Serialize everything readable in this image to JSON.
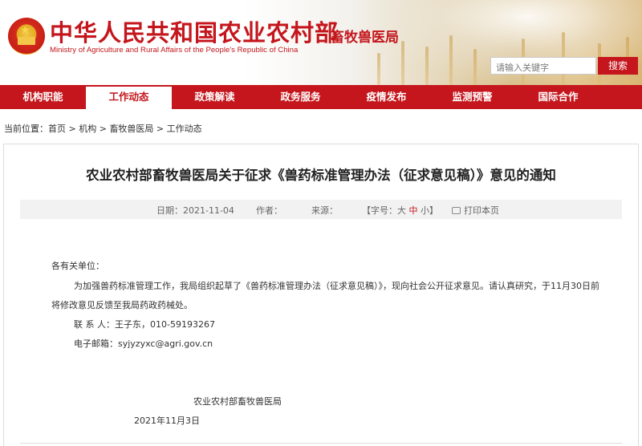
{
  "header": {
    "ministry_cn": "中华人民共和国农业农村部",
    "ministry_en": "Ministry of Agriculture and Rural Affairs of the People's Republic of China",
    "bureau": "畜牧兽医局",
    "search_placeholder": "请输入关键字",
    "search_button": "搜索",
    "brand_color": "#c4161c"
  },
  "nav": {
    "items": [
      {
        "label": "机构职能"
      },
      {
        "label": "工作动态"
      },
      {
        "label": "政策解读"
      },
      {
        "label": "政务服务"
      },
      {
        "label": "疫情发布"
      },
      {
        "label": "监测预警"
      },
      {
        "label": "国际合作"
      }
    ],
    "active": "工作动态"
  },
  "breadcrumb": {
    "prefix": "当前位置：",
    "items": [
      "首页",
      "机构",
      "畜牧兽医局",
      "工作动态"
    ],
    "separator": " > "
  },
  "article": {
    "title": "农业农村部畜牧兽医局关于征求《兽药标准管理办法（征求意见稿）》意见的通知",
    "meta": {
      "date_label": "日期：",
      "date": "2021-11-04",
      "author_label": "作者：",
      "source_label": "来源：",
      "font_label": "【字号：",
      "font_big": "大",
      "font_mid": "中",
      "font_small": "小",
      "font_close": "】",
      "print": "打印本页"
    },
    "salutation": "各有关单位：",
    "body_line1": "为加强兽药标准管理工作，我局组织起草了《兽药标准管理办法（征求意见稿）》，现向社会公开征求意见。请认真研究，于11月30日前",
    "body_line2": "将修改意见反馈至我局药政药械处。",
    "contact": "联 系 人：王子东，010-59193267",
    "email": "电子邮箱：syjyzyxc@agri.gov.cn",
    "signature": "农业农村部畜牧兽医局",
    "sign_date": "2021年11月3日"
  }
}
